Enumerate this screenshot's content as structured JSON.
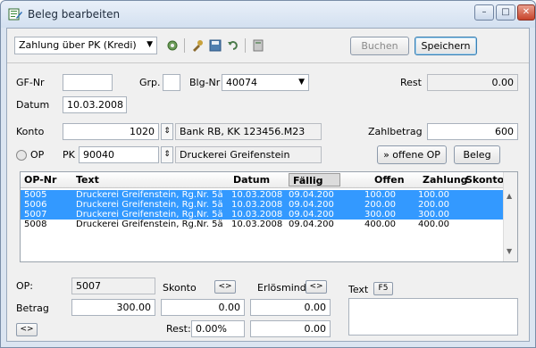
{
  "window": {
    "title": "Beleg bearbeiten",
    "minimize": "–",
    "maximize": "□",
    "close": "✕"
  },
  "toolbar": {
    "payment_type": "Zahlung über PK (Kredi)",
    "buchen": "Buchen",
    "speichern": "Speichern"
  },
  "form": {
    "gf_nr_label": "GF-Nr",
    "gf_nr": "",
    "grp_label": "Grp.",
    "grp": "",
    "blg_nr_label": "Blg-Nr",
    "blg_nr": "40074",
    "rest_label": "Rest",
    "rest": "0.00",
    "datum_label": "Datum",
    "datum": "10.03.2008",
    "konto_label": "Konto",
    "konto": "1020",
    "konto_name": "Bank RB, KK 123456.M23",
    "zahlbetrag_label": "Zahlbetrag",
    "zahlbetrag": "600",
    "op_label": "OP",
    "pk_label": "PK",
    "pk": "90040",
    "pk_name": "Druckerei Greifenstein",
    "offene_op_button": "» offene OP",
    "beleg_button": "Beleg"
  },
  "table": {
    "columns": [
      "OP-Nr",
      "Text",
      "Datum",
      "Fällig",
      "Offen",
      "Zahlung",
      "Skonto"
    ],
    "rows": [
      {
        "op": "5005",
        "text": "Druckerei Greifenstein, Rg.Nr. 5ä",
        "datum": "10.03.2008",
        "faellig": "09.04.200",
        "offen": "100.00",
        "zahlung": "100.00",
        "skonto": "",
        "selected": true
      },
      {
        "op": "5006",
        "text": "Druckerei Greifenstein, Rg.Nr. 5ä",
        "datum": "10.03.2008",
        "faellig": "09.04.200",
        "offen": "200.00",
        "zahlung": "200.00",
        "skonto": "",
        "selected": true
      },
      {
        "op": "5007",
        "text": "Druckerei Greifenstein, Rg.Nr. 5ä",
        "datum": "10.03.2008",
        "faellig": "09.04.200",
        "offen": "300.00",
        "zahlung": "300.00",
        "skonto": "",
        "selected": true
      },
      {
        "op": "5008",
        "text": "Druckerei Greifenstein, Rg.Nr. 5ä",
        "datum": "10.03.2008",
        "faellig": "09.04.200",
        "offen": "400.00",
        "zahlung": "400.00",
        "skonto": "",
        "selected": false
      }
    ]
  },
  "detail": {
    "op_label": "OP:",
    "op": "5007",
    "skonto_label": "Skonto",
    "skonto": "0.00",
    "erloesmind_label": "Erlösmind.",
    "erloesmind": "0.00",
    "text_label": "Text",
    "f5": "F5",
    "betrag_label": "Betrag",
    "betrag": "300.00",
    "rest_label": "Rest:",
    "rest_pct": "0.00%",
    "rest_value": "0.00",
    "swap": "<>"
  }
}
